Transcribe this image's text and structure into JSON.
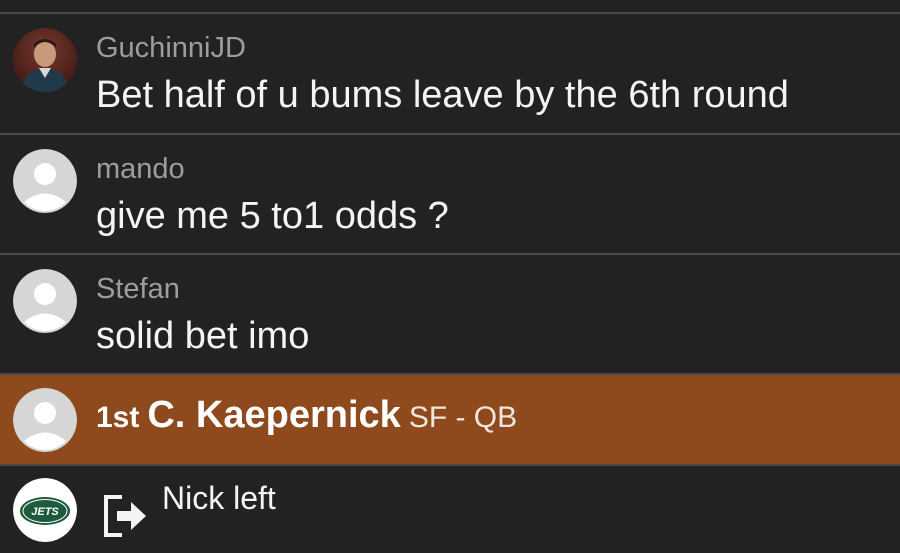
{
  "messages": [
    {
      "username": "GuchinniJD",
      "text": "Bet half of u bums leave by the 6th round",
      "avatar": "photo-avatar"
    },
    {
      "username": "mando",
      "text": "give me 5 to1 odds ?",
      "avatar": "default-avatar-icon"
    },
    {
      "username": "Stefan",
      "text": "solid bet imo",
      "avatar": "default-avatar-icon"
    }
  ],
  "pick": {
    "round": "1st",
    "player": "C. Kaepernick",
    "team_position": "SF - QB",
    "avatar": "default-avatar-icon",
    "highlight_color": "#8e4a1d"
  },
  "event": {
    "text": "Nick left",
    "icon": "exit-icon",
    "avatar": "jets-logo",
    "team_logo_text": "JETS"
  },
  "colors": {
    "background": "#222222",
    "divider": "#4a4a4a",
    "username": "#9d9d9d",
    "message": "#f4f4f4",
    "jets_green": "#1e5a3c"
  }
}
